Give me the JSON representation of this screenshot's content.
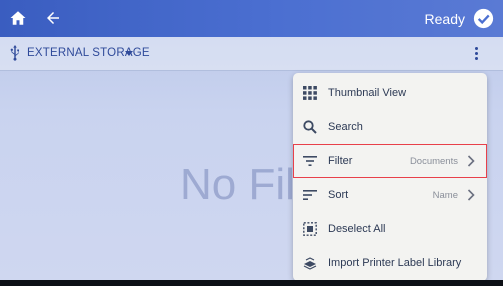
{
  "topbar": {
    "status": "Ready"
  },
  "header": {
    "storage_label": "EXTERNAL STORAGE"
  },
  "main": {
    "empty_text": "No File"
  },
  "menu": {
    "items": [
      {
        "label": "Thumbnail View",
        "value": ""
      },
      {
        "label": "Search",
        "value": ""
      },
      {
        "label": "Filter",
        "value": "Documents"
      },
      {
        "label": "Sort",
        "value": "Name"
      },
      {
        "label": "Deselect All",
        "value": ""
      },
      {
        "label": "Import Printer Label Library",
        "value": ""
      }
    ]
  },
  "icons": {
    "home": "home-icon",
    "back": "back-arrow-icon",
    "ready": "check-circle-icon",
    "usb": "usb-icon",
    "kebab": "more-vert-icon",
    "grid": "grid-icon",
    "search": "search-icon",
    "filter": "filter-icon",
    "sort": "sort-icon",
    "deselect": "deselect-icon",
    "import": "import-icon"
  },
  "colors": {
    "accent": "#3a5dc0",
    "highlight": "#e8404a"
  }
}
